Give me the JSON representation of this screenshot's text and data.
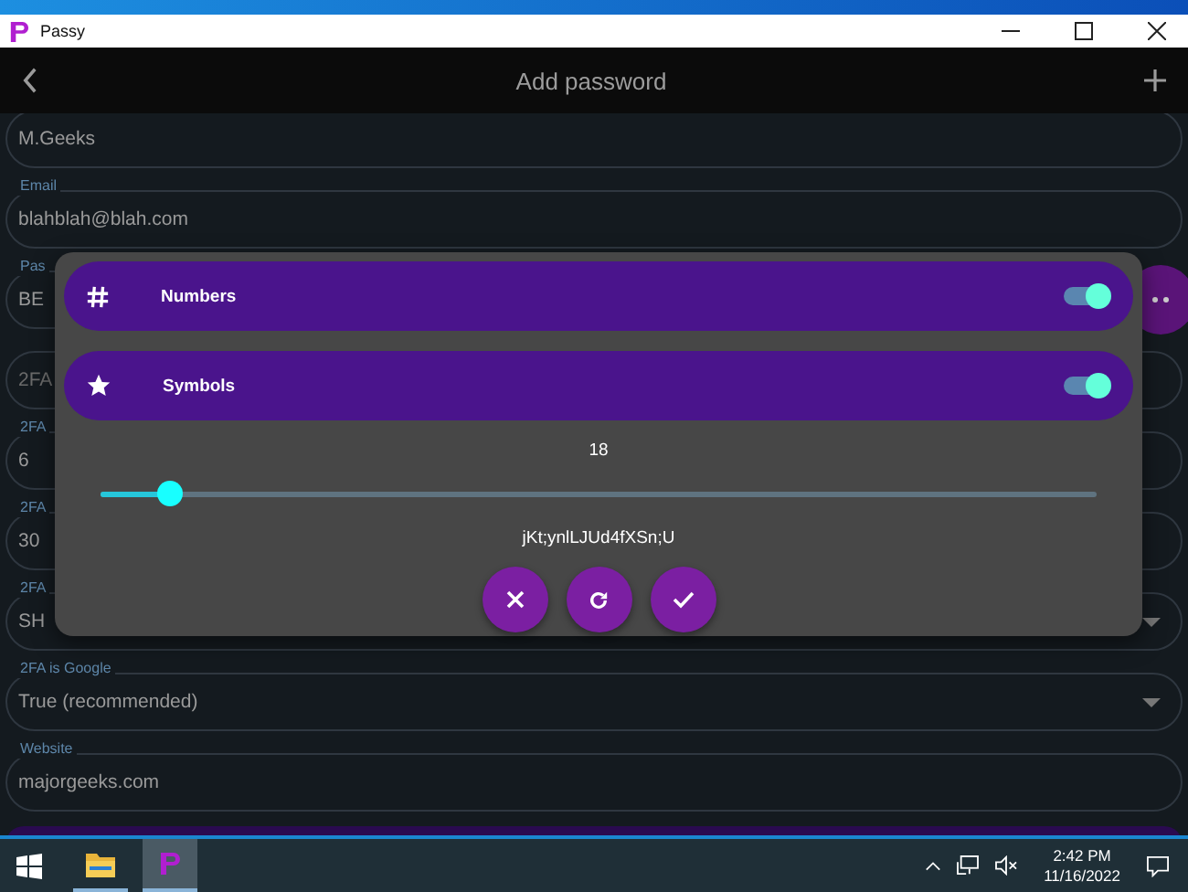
{
  "window": {
    "title": "Passy"
  },
  "app_bar": {
    "title": "Add password"
  },
  "fields": [
    {
      "kind": "text",
      "value": "M.Geeks"
    },
    {
      "kind": "text",
      "label": "Email",
      "value": "blahblah@blah.com"
    },
    {
      "kind": "password",
      "label": "Pas",
      "value": "BE"
    },
    {
      "kind": "text",
      "placeholder": "2FA"
    },
    {
      "kind": "text",
      "label": "2FA",
      "value": "6"
    },
    {
      "kind": "text",
      "label": "2FA",
      "value": "30"
    },
    {
      "kind": "select",
      "label": "2FA",
      "value": "SH"
    },
    {
      "kind": "select",
      "label": "2FA is Google",
      "value": "True (recommended)"
    },
    {
      "kind": "text",
      "label": "Website",
      "value": "majorgeeks.com"
    }
  ],
  "dialog": {
    "options": [
      {
        "kind": "hash",
        "label": "Numbers",
        "on": true
      },
      {
        "kind": "star",
        "label": "Symbols",
        "on": true
      }
    ],
    "length": "18",
    "slider": {
      "level": 0.07
    },
    "generated": "jKt;ynlLJUd4fXSn;U",
    "buttons": [
      {
        "kind": "cancel"
      },
      {
        "kind": "refresh"
      },
      {
        "kind": "confirm"
      }
    ]
  },
  "taskbar": {
    "time": "2:42 PM",
    "date": "11/16/2022"
  }
}
